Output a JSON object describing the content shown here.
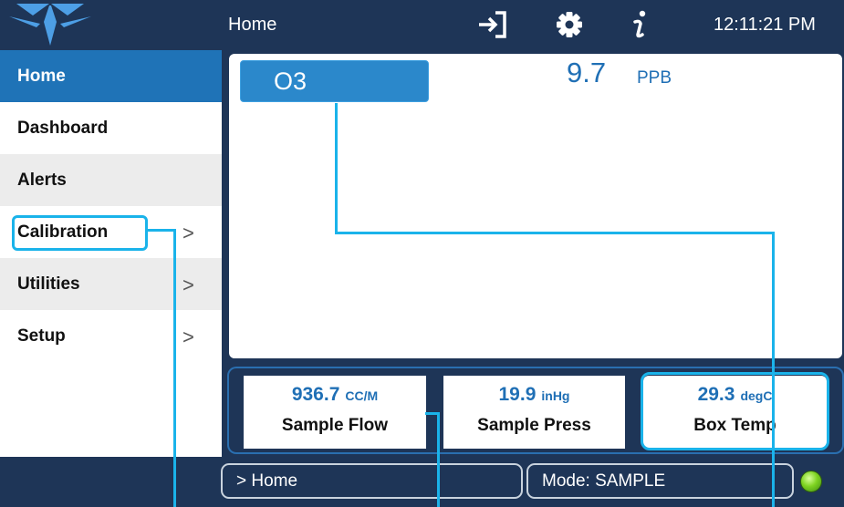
{
  "header": {
    "title": "Home",
    "clock": "12:11:21 PM",
    "icons": [
      "teledyne-logo-icon",
      "logout-icon",
      "gear-icon",
      "info-icon"
    ]
  },
  "sidebar": {
    "items": [
      {
        "label": "Home",
        "has_submenu": false,
        "active": true
      },
      {
        "label": "Dashboard",
        "has_submenu": false,
        "active": false
      },
      {
        "label": "Alerts",
        "has_submenu": false,
        "active": false
      },
      {
        "label": "Calibration",
        "has_submenu": true,
        "active": false
      },
      {
        "label": "Utilities",
        "has_submenu": true,
        "active": false
      },
      {
        "label": "Setup",
        "has_submenu": true,
        "active": false
      }
    ],
    "chevron": ">"
  },
  "main": {
    "gas_name": "O3",
    "gas_value": "9.7",
    "gas_unit": "PPB"
  },
  "dashboard": {
    "tiles": [
      {
        "value": "936.7",
        "unit": "CC/M",
        "label": "Sample Flow"
      },
      {
        "value": "19.9",
        "unit": "inHg",
        "label": "Sample Press"
      },
      {
        "value": "29.3",
        "unit": "degC",
        "label": "Box Temp"
      }
    ]
  },
  "status": {
    "path": "> Home",
    "mode": "Mode: SAMPLE",
    "led_color": "#7ed321"
  },
  "colors": {
    "navy": "#1e3557",
    "accent_blue": "#1f73b7",
    "callout_cyan": "#1ab3ea",
    "value_blue": "#1f6fb5"
  }
}
